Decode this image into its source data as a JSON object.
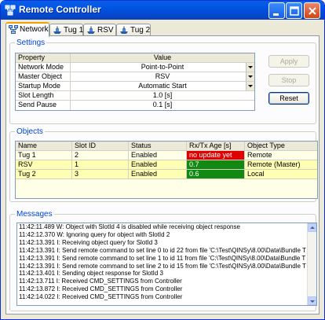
{
  "window": {
    "title": "Remote Controller"
  },
  "tabs": [
    {
      "label": "Network",
      "icon": "network-icon"
    },
    {
      "label": "Tug 1",
      "icon": "ship-icon"
    },
    {
      "label": "RSV",
      "icon": "ship-icon"
    },
    {
      "label": "Tug 2",
      "icon": "ship-icon"
    }
  ],
  "settings": {
    "title": "Settings",
    "header": {
      "property": "Property",
      "value": "Value"
    },
    "rows": [
      {
        "property": "Network Mode",
        "value": "Point-to-Point",
        "dropdown": true
      },
      {
        "property": "Master Object",
        "value": "RSV",
        "dropdown": true
      },
      {
        "property": "Startup Mode",
        "value": "Automatic Start",
        "dropdown": true
      },
      {
        "property": "Slot Length",
        "value": "1.0 [s]",
        "dropdown": false
      },
      {
        "property": "Send Pause",
        "value": "0.1 [s]",
        "dropdown": false
      }
    ],
    "buttons": {
      "apply": "Apply",
      "stop": "Stop",
      "reset": "Reset"
    }
  },
  "objects": {
    "title": "Objects",
    "columns": [
      "Name",
      "Slot ID",
      "Status",
      "Rx/Tx Age [s]",
      "Object Type"
    ],
    "rows": [
      {
        "name": "Tug 1",
        "slot_id": "2",
        "status": "Enabled",
        "age": "no update yet",
        "type": "Remote",
        "age_color": "#e00000"
      },
      {
        "name": "RSV",
        "slot_id": "1",
        "status": "Enabled",
        "age": "0.7",
        "type": "Remote (Master)",
        "age_color": "#128a12"
      },
      {
        "name": "Tug 2",
        "slot_id": "3",
        "status": "Enabled",
        "age": "0.6",
        "type": "Local",
        "age_color": "#128a12"
      }
    ]
  },
  "messages": {
    "title": "Messages",
    "lines": [
      "11:42:11.489 W: Object with SlotId 4 is disabled while receiving object response",
      "11:42:12.370 W: Ignoring query for object with SlotId 2",
      "11:42:13.391 I: Receiving object query for SlotId 3",
      "11:42:13.391 I: Send remote command to set line 0 to id 22 from file 'C:\\Test\\QINSy\\8.00\\Data\\Bundle T",
      "11:42:13.391 I: Send remote command to set line 1 to id 11 from file 'C:\\Test\\QINSy\\8.00\\Data\\Bundle T",
      "11:42:13.391 I: Send remote command to set line 2 to id 15 from file 'C:\\Test\\QINSy\\8.00\\Data\\Bundle T",
      "11:42:13.401 I: Sending object response for SlotId 3",
      "11:42:13.711 I: Received CMD_SETTINGS from Controller",
      "11:42:13.872 I: Received CMD_SETTINGS from Controller",
      "11:42:14.022 I: Received CMD_SETTINGS from Controller"
    ]
  }
}
